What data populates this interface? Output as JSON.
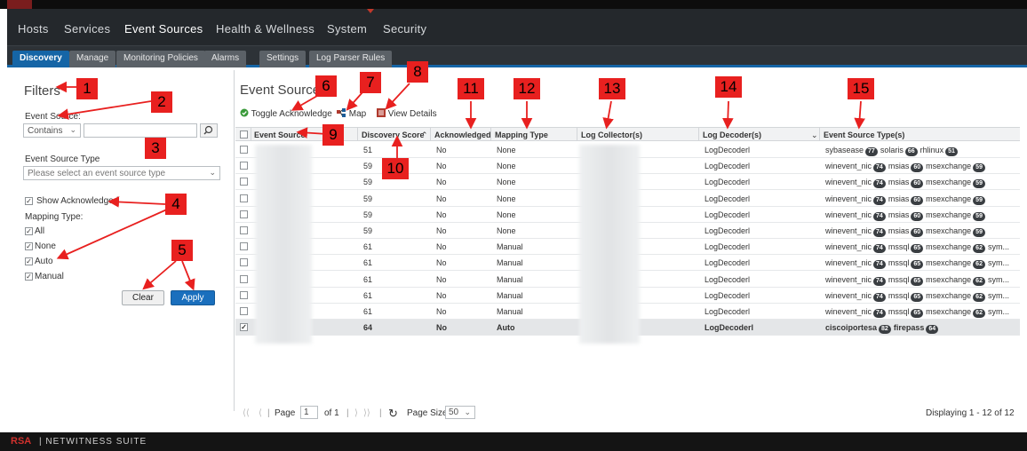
{
  "nav": [
    "Hosts",
    "Services",
    "Event Sources",
    "Health & Wellness",
    "System",
    "Security"
  ],
  "tabs": [
    "Discovery",
    "Manage",
    "Monitoring Policies",
    "Alarms",
    "Settings",
    "Log Parser Rules"
  ],
  "filters": {
    "title": "Filters",
    "event_source_label": "Event Source:",
    "operator_value": "Contains",
    "type_label": "Event Source Type",
    "type_placeholder": "Please select an event source type",
    "show_ack_label": "Show Acknowledged",
    "mapping_label": "Mapping Type:",
    "mapping_options": [
      "All",
      "None",
      "Auto",
      "Manual"
    ],
    "clear_label": "Clear",
    "apply_label": "Apply"
  },
  "main": {
    "title": "Event Sources",
    "toggle_ack_label": "Toggle Acknowledge",
    "map_label": "Map",
    "view_details_label": "View Details"
  },
  "columns": [
    "Event Source",
    "Discovery Score",
    "Acknowledged",
    "Mapping Type",
    "Log Collector(s)",
    "Log Decoder(s)",
    "Event Source Type(s)"
  ],
  "rows": [
    {
      "score": "51",
      "ack": "No",
      "mapping": "None",
      "decoder": "LogDecoderl",
      "types": [
        [
          "sybasease",
          "77"
        ],
        [
          "solaris",
          "66"
        ],
        [
          "rhlinux",
          "51"
        ]
      ],
      "more": ""
    },
    {
      "score": "59",
      "ack": "No",
      "mapping": "None",
      "decoder": "LogDecoderl",
      "types": [
        [
          "winevent_nic",
          "74"
        ],
        [
          "msias",
          "60"
        ],
        [
          "msexchange",
          "59"
        ]
      ],
      "more": ""
    },
    {
      "score": "59",
      "ack": "No",
      "mapping": "None",
      "decoder": "LogDecoderl",
      "types": [
        [
          "winevent_nic",
          "74"
        ],
        [
          "msias",
          "60"
        ],
        [
          "msexchange",
          "59"
        ]
      ],
      "more": ""
    },
    {
      "score": "59",
      "ack": "No",
      "mapping": "None",
      "decoder": "LogDecoderl",
      "types": [
        [
          "winevent_nic",
          "74"
        ],
        [
          "msias",
          "60"
        ],
        [
          "msexchange",
          "59"
        ]
      ],
      "more": ""
    },
    {
      "score": "59",
      "ack": "No",
      "mapping": "None",
      "decoder": "LogDecoderl",
      "types": [
        [
          "winevent_nic",
          "74"
        ],
        [
          "msias",
          "60"
        ],
        [
          "msexchange",
          "59"
        ]
      ],
      "more": ""
    },
    {
      "score": "59",
      "ack": "No",
      "mapping": "None",
      "decoder": "LogDecoderl",
      "types": [
        [
          "winevent_nic",
          "74"
        ],
        [
          "msias",
          "60"
        ],
        [
          "msexchange",
          "59"
        ]
      ],
      "more": ""
    },
    {
      "score": "61",
      "ack": "No",
      "mapping": "Manual",
      "decoder": "LogDecoderl",
      "types": [
        [
          "winevent_nic",
          "74"
        ],
        [
          "mssql",
          "65"
        ],
        [
          "msexchange",
          "62"
        ]
      ],
      "more": "sym..."
    },
    {
      "score": "61",
      "ack": "No",
      "mapping": "Manual",
      "decoder": "LogDecoderl",
      "types": [
        [
          "winevent_nic",
          "74"
        ],
        [
          "mssql",
          "65"
        ],
        [
          "msexchange",
          "62"
        ]
      ],
      "more": "sym..."
    },
    {
      "score": "61",
      "ack": "No",
      "mapping": "Manual",
      "decoder": "LogDecoderl",
      "types": [
        [
          "winevent_nic",
          "74"
        ],
        [
          "mssql",
          "65"
        ],
        [
          "msexchange",
          "62"
        ]
      ],
      "more": "sym..."
    },
    {
      "score": "61",
      "ack": "No",
      "mapping": "Manual",
      "decoder": "LogDecoderl",
      "types": [
        [
          "winevent_nic",
          "74"
        ],
        [
          "mssql",
          "65"
        ],
        [
          "msexchange",
          "62"
        ]
      ],
      "more": "sym..."
    },
    {
      "score": "61",
      "ack": "No",
      "mapping": "Manual",
      "decoder": "LogDecoderl",
      "types": [
        [
          "winevent_nic",
          "74"
        ],
        [
          "mssql",
          "65"
        ],
        [
          "msexchange",
          "62"
        ]
      ],
      "more": "sym..."
    },
    {
      "score": "64",
      "ack": "No",
      "mapping": "Auto",
      "decoder": "LogDecoderl",
      "types": [
        [
          "ciscoiportesa",
          "82"
        ],
        [
          "firepass",
          "64"
        ]
      ],
      "more": "",
      "selected": true
    }
  ],
  "pager": {
    "page_label": "Page",
    "page_value": "1",
    "of_label": "of 1",
    "page_size_label": "Page Size",
    "page_size_value": "50",
    "displaying": "Displaying 1 - 12 of 12"
  },
  "footer": {
    "brand": "RSA",
    "product": "NETWITNESS SUITE"
  },
  "callouts": [
    "1",
    "2",
    "3",
    "4",
    "5",
    "6",
    "7",
    "8",
    "9",
    "10",
    "11",
    "12",
    "13",
    "14",
    "15"
  ]
}
